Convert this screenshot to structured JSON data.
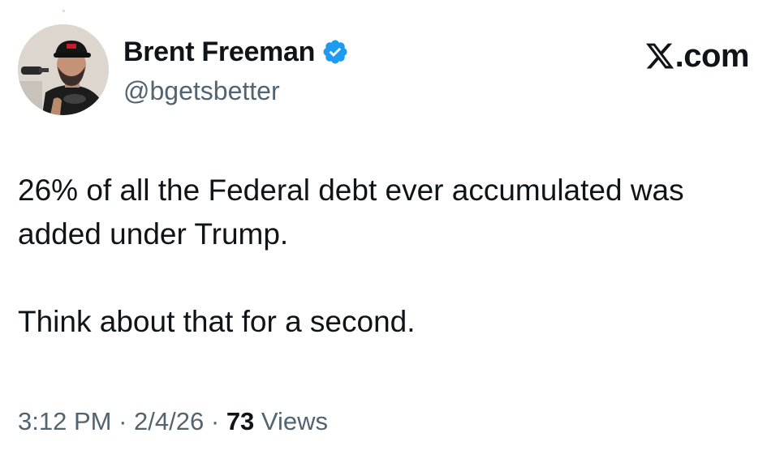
{
  "author": {
    "display_name": "Brent Freeman",
    "handle": "@bgetsbetter",
    "verified": true,
    "avatar": "avatar-photo"
  },
  "brand": {
    "logo": "x-logo-icon",
    "suffix": ".com"
  },
  "tweet": {
    "paragraphs": [
      "26% of all the Federal debt ever accumulated was added under Trump.",
      "Think about that for a second."
    ]
  },
  "meta": {
    "time": "3:12 PM",
    "date": "2/4/26",
    "separator": "·",
    "views_count": "73",
    "views_label": "Views"
  },
  "colors": {
    "text": "#0f1419",
    "secondary": "#536471",
    "verified": "#1d9bf0"
  }
}
